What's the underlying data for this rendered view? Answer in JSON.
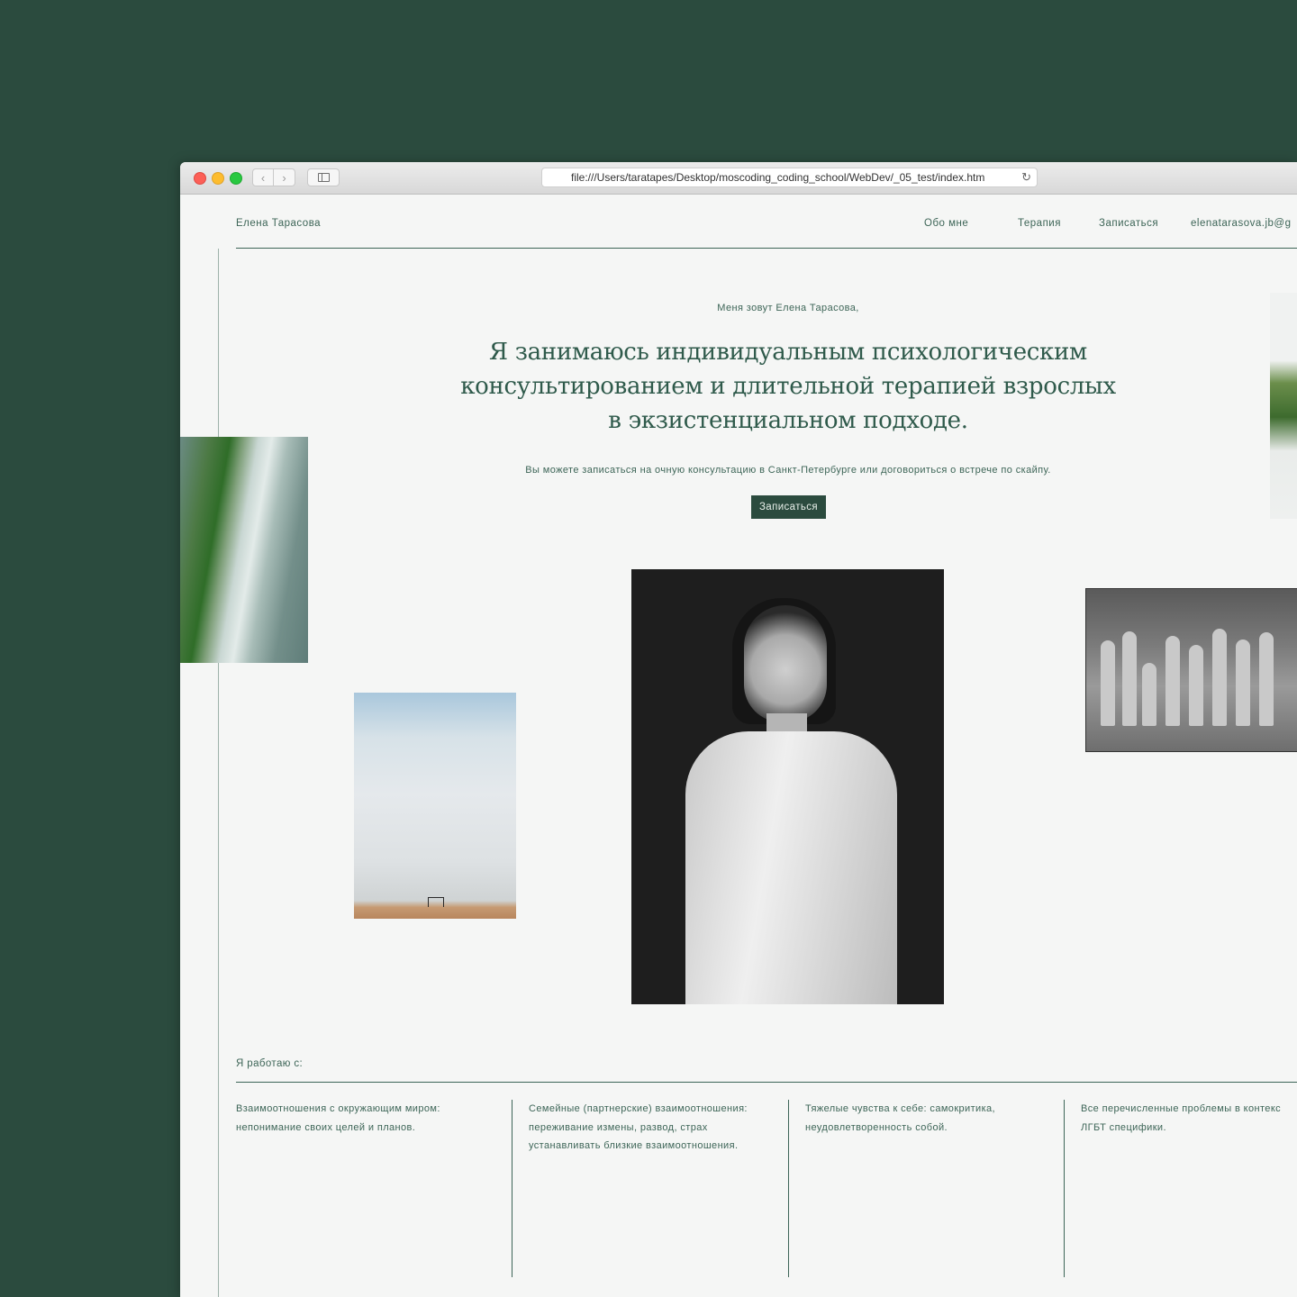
{
  "browser": {
    "url": "file:///Users/taratapes/Desktop/moscoding_coding_school/WebDev/_05_test/index.htm"
  },
  "header": {
    "brand": "Елена Тарасова",
    "nav": [
      "Обо мне",
      "Терапия",
      "Записаться",
      "elenatarasova.jb@g"
    ]
  },
  "hero": {
    "intro": "Меня зовут Елена Тарасова,",
    "headline_lines": [
      "Я занимаюсь индивидуальным психологическим",
      "консультированием и длительной терапией взрослых",
      "в экзистенциальном подходе."
    ],
    "subtext": "Вы можете записаться на очную консультацию в Санкт-Петербурге или договориться о встрече по скайпу.",
    "cta": "Записаться"
  },
  "works": {
    "label": "Я работаю с:",
    "columns": [
      [
        "Взаимоотношения с окружающим миром:",
        "непонимание своих целей и планов."
      ],
      [
        "Семейные (партнерские) взаимоотношения:",
        "переживание измены, развод, страх",
        "устанавливать близкие взаимоотношения."
      ],
      [
        "Тяжелые чувства к себе: самокритика,",
        "неудовлетворенность собой."
      ],
      [
        "Все перечисленные проблемы в контекс",
        "ЛГБТ специфики."
      ]
    ]
  },
  "colors": {
    "page_bg": "#2b4b3e",
    "site_bg": "#f5f6f5",
    "accent": "#3d6557",
    "button_bg": "#2b4b3e"
  }
}
